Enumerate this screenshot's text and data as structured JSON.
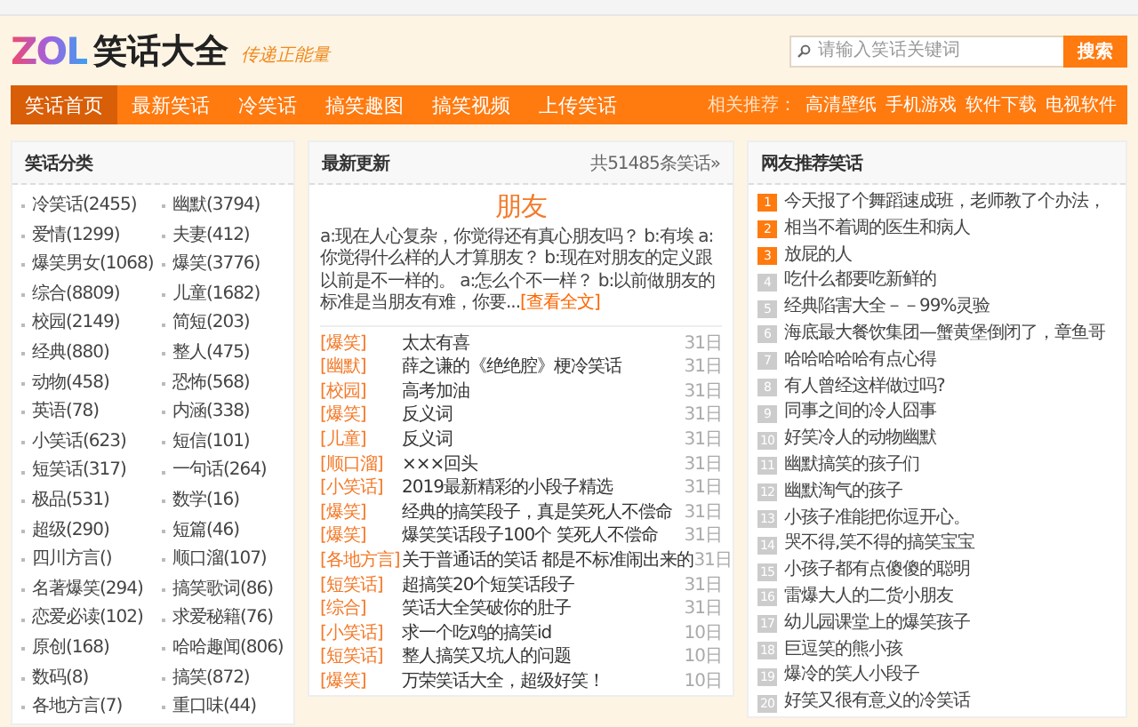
{
  "header": {
    "logo": "ZOL",
    "site_title": "笑话大全",
    "slogan": "传递正能量",
    "search": {
      "placeholder": "请输入笑话关键词",
      "button": "搜索"
    }
  },
  "nav": {
    "tabs": [
      {
        "label": "笑话首页",
        "selected": true
      },
      {
        "label": "最新笑话",
        "selected": false
      },
      {
        "label": "冷笑话",
        "selected": false
      },
      {
        "label": "搞笑趣图",
        "selected": false
      },
      {
        "label": "搞笑视频",
        "selected": false
      },
      {
        "label": "上传笑话",
        "selected": false
      }
    ],
    "related_label": "相关推荐：",
    "related_links": [
      "高清壁纸",
      "手机游戏",
      "软件下载",
      "电视软件"
    ]
  },
  "categories": {
    "title": "笑话分类",
    "items": [
      "冷笑话(2455)",
      "幽默(3794)",
      "爱情(1299)",
      "夫妻(412)",
      "爆笑男女(1068)",
      "爆笑(3776)",
      "综合(8809)",
      "儿童(1682)",
      "校园(2149)",
      "简短(203)",
      "经典(880)",
      "整人(475)",
      "动物(458)",
      "恐怖(568)",
      "英语(78)",
      "内涵(338)",
      "小笑话(623)",
      "短信(101)",
      "短笑话(317)",
      "一句话(264)",
      "极品(531)",
      "数学(16)",
      "超级(290)",
      "短篇(46)",
      "四川方言()",
      "顺口溜(107)",
      "名著爆笑(294)",
      "搞笑歌词(86)",
      "恋爱必读(102)",
      "求爱秘籍(76)",
      "原创(168)",
      "哈哈趣闻(806)",
      "数码(8)",
      "搞笑(872)",
      "各地方言(7)",
      "重口味(44)"
    ]
  },
  "latest": {
    "title": "最新更新",
    "total": "共51485条笑话»",
    "featured": {
      "title": "朋友",
      "excerpt": "a:现在人心复杂，你觉得还有真心朋友吗？ b:有埃 a:你觉得什么样的人才算朋友？ b:现在对朋友的定义跟以前是不一样的。 a:怎么个不一样？ b:以前做朋友的标准是当朋友有难，你要...",
      "more": "[查看全文]"
    },
    "rows": [
      {
        "tag": "[爆笑]",
        "title": "太太有喜",
        "date": "31日"
      },
      {
        "tag": "[幽默]",
        "title": "薛之谦的《绝绝腔》梗冷笑话",
        "date": "31日"
      },
      {
        "tag": "[校园]",
        "title": "高考加油",
        "date": "31日"
      },
      {
        "tag": "[爆笑]",
        "title": "反义词",
        "date": "31日"
      },
      {
        "tag": "[儿童]",
        "title": "反义词",
        "date": "31日"
      },
      {
        "tag": "[顺口溜]",
        "title": "×××回头",
        "date": "31日"
      },
      {
        "tag": "[小笑话]",
        "title": "2019最新精彩的小段子精选",
        "date": "31日"
      },
      {
        "tag": "[爆笑]",
        "title": "经典的搞笑段子，真是笑死人不偿命",
        "date": "31日"
      },
      {
        "tag": "[爆笑]",
        "title": "爆笑笑话段子100个 笑死人不偿命",
        "date": "31日"
      },
      {
        "tag": "[各地方言]",
        "title": "关于普通话的笑话 都是不标准闹出来的",
        "date": "31日"
      },
      {
        "tag": "[短笑话]",
        "title": "超搞笑20个短笑话段子",
        "date": "31日"
      },
      {
        "tag": "[综合]",
        "title": "笑话大全笑破你的肚子",
        "date": "31日"
      },
      {
        "tag": "[小笑话]",
        "title": "求一个吃鸡的搞笑id",
        "date": "10日"
      },
      {
        "tag": "[短笑话]",
        "title": "整人搞笑又坑人的问题",
        "date": "10日"
      },
      {
        "tag": "[爆笑]",
        "title": "万荣笑话大全，超级好笑！",
        "date": "10日"
      }
    ]
  },
  "recommend": {
    "title": "网友推荐笑话",
    "items": [
      {
        "rank": "1",
        "hot": true,
        "title": "今天报了个舞蹈速成班，老师教了个办法，"
      },
      {
        "rank": "2",
        "hot": true,
        "title": "相当不着调的医生和病人"
      },
      {
        "rank": "3",
        "hot": true,
        "title": "放屁的人"
      },
      {
        "rank": "4",
        "hot": false,
        "title": "吃什么都要吃新鲜的"
      },
      {
        "rank": "5",
        "hot": false,
        "title": "经典陷害大全－－99%灵验"
      },
      {
        "rank": "6",
        "hot": false,
        "title": "海底最大餐饮集团—蟹黄堡倒闭了，章鱼哥"
      },
      {
        "rank": "7",
        "hot": false,
        "title": "哈哈哈哈哈有点心得"
      },
      {
        "rank": "8",
        "hot": false,
        "title": "有人曾经这样做过吗?"
      },
      {
        "rank": "9",
        "hot": false,
        "title": "同事之间的冷人囧事"
      },
      {
        "rank": "10",
        "hot": false,
        "title": "好笑冷人的动物幽默"
      },
      {
        "rank": "11",
        "hot": false,
        "title": "幽默搞笑的孩子们"
      },
      {
        "rank": "12",
        "hot": false,
        "title": "幽默淘气的孩子"
      },
      {
        "rank": "13",
        "hot": false,
        "title": "小孩子准能把你逗开心。"
      },
      {
        "rank": "14",
        "hot": false,
        "title": "哭不得,笑不得的搞笑宝宝"
      },
      {
        "rank": "15",
        "hot": false,
        "title": "小孩子都有点傻傻的聪明"
      },
      {
        "rank": "16",
        "hot": false,
        "title": "雷爆大人的二货小朋友"
      },
      {
        "rank": "17",
        "hot": false,
        "title": "幼儿园课堂上的爆笑孩子"
      },
      {
        "rank": "18",
        "hot": false,
        "title": "巨逗笑的熊小孩"
      },
      {
        "rank": "19",
        "hot": false,
        "title": "爆冷的笑人小段子"
      },
      {
        "rank": "20",
        "hot": false,
        "title": "好笑又很有意义的冷笑话"
      }
    ]
  }
}
